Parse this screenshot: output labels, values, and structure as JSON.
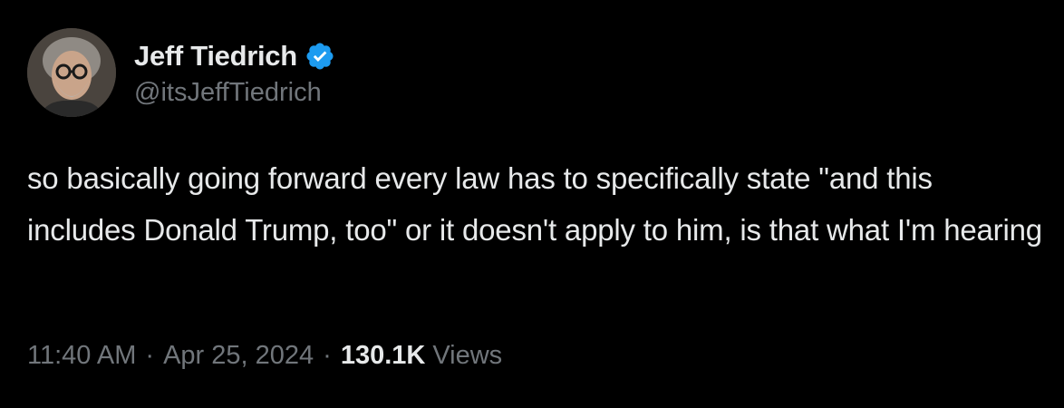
{
  "author": {
    "display_name": "Jeff Tiedrich",
    "handle": "@itsJeffTiedrich",
    "verified": true,
    "avatar_icon": "avatar-photo",
    "verified_icon": "verified-badge-icon"
  },
  "tweet": {
    "text": "so basically going forward every law has to specifically state \"and this includes Donald Trump, too\" or it doesn't apply to him, is that what I'm hearing"
  },
  "meta": {
    "time": "11:40 AM",
    "separator": "·",
    "date": "Apr 25, 2024",
    "views_count": "130.1K",
    "views_label": "Views"
  },
  "colors": {
    "background": "#000000",
    "primary_text": "#e7e9ea",
    "secondary_text": "#71767b",
    "verified_blue": "#1d9bf0"
  }
}
